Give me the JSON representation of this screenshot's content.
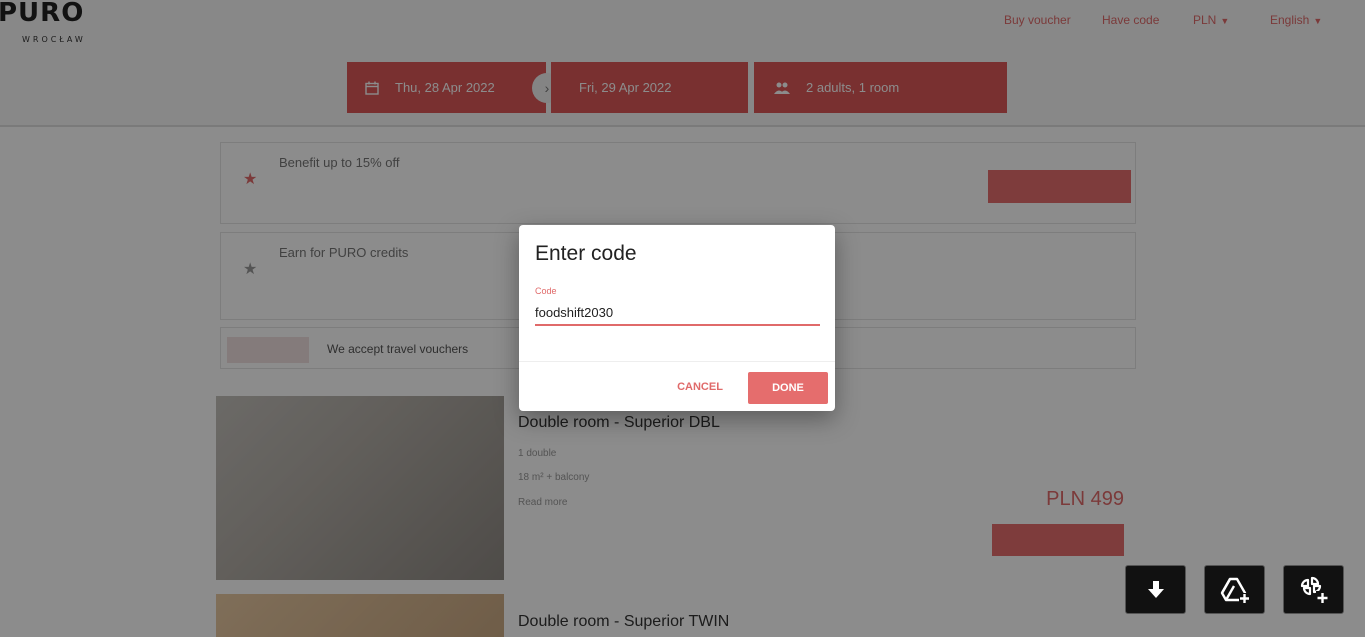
{
  "header": {
    "logo_text": "PURO",
    "logo_subtext": "WROCŁAW",
    "top_links": {
      "buy_voucher": "Buy voucher",
      "have_code": "Have code",
      "currency": "PLN",
      "language": "English"
    },
    "search": {
      "date_from": "Thu, 28 Apr 2022",
      "date_to": "Fri, 29 Apr 2022",
      "guests": "2 adults, 1 room"
    }
  },
  "promos": [
    {
      "title": "Benefit up to 15% off",
      "text": "",
      "button": ""
    },
    {
      "title": "Earn for PURO credits",
      "text": ""
    },
    {
      "text": "We accept travel vouchers"
    }
  ],
  "rooms": [
    {
      "title": "Double room - Superior DBL",
      "bed": "1 double",
      "size": "18 m² + balcony",
      "more": "Read more",
      "old_price_label": "",
      "old_price": "",
      "price_from_label": "",
      "price": "PLN 499",
      "button": ""
    },
    {
      "title": "Double room - Superior TWIN"
    }
  ],
  "dialog": {
    "title": "Enter code",
    "field_label": "Code",
    "field_value": "foodshift2030",
    "cancel_label": "CANCEL",
    "done_label": "DONE"
  },
  "colors": {
    "accent": "#e06a6a",
    "accent_button": "#e56d6d",
    "search_bar": "#dc5858",
    "overlay": "rgba(0,0,0,0.45)"
  },
  "floating_buttons": [
    "download-icon",
    "google-drive-add-icon",
    "google-photos-add-icon"
  ]
}
